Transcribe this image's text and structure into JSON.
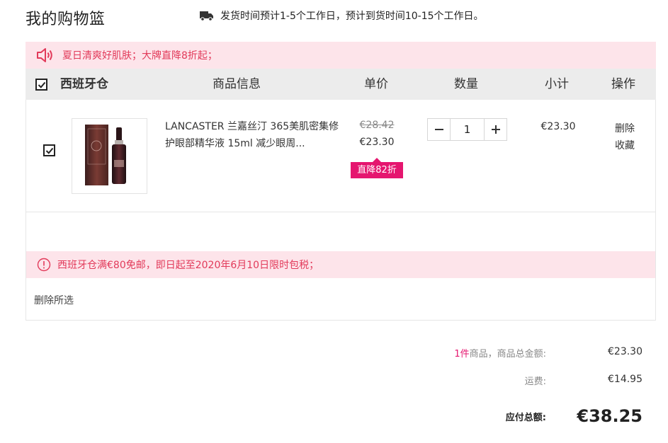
{
  "header": {
    "title": "我的购物篮",
    "shipping_note": "发货时间预计1-5个工作日，预计到货时间10-15个工作日。"
  },
  "promo": {
    "text": "夏日清爽好肌肤；大牌直降8折起；"
  },
  "table_header": {
    "store": "西班牙仓",
    "col_info": "商品信息",
    "col_price": "单价",
    "col_qty": "数量",
    "col_subtotal": "小计",
    "col_action": "操作"
  },
  "item": {
    "name": "LANCASTER 兰嘉丝汀 365美肌密集修护眼部精华液 15ml 减少眼周...",
    "old_price": "€28.42",
    "price": "€23.30",
    "discount": "直降82折",
    "quantity": "1",
    "subtotal": "€23.30",
    "delete_label": "删除",
    "favorite_label": "收藏",
    "checked": true
  },
  "tax_notice": {
    "text": "西班牙仓满€80免邮，即日起至2020年6月10日限时包税；"
  },
  "actions": {
    "delete_selected": "删除所选"
  },
  "summary": {
    "count": "1件",
    "goods_label": "商品，商品总金额:",
    "goods_total": "€23.30",
    "shipping_label": "运费:",
    "shipping": "€14.95",
    "payable_label": "应付总额:",
    "payable": "€38.25"
  },
  "colors": {
    "accent": "#e5166f",
    "banner_bg": "#fde4ea",
    "banner_text": "#e23a5a",
    "header_bg": "#ececec"
  },
  "icons": {
    "truck": "truck-icon",
    "speaker": "speaker-icon",
    "alert": "alert-circle-icon",
    "check": "check-icon",
    "minus": "minus-icon",
    "plus": "plus-icon"
  }
}
